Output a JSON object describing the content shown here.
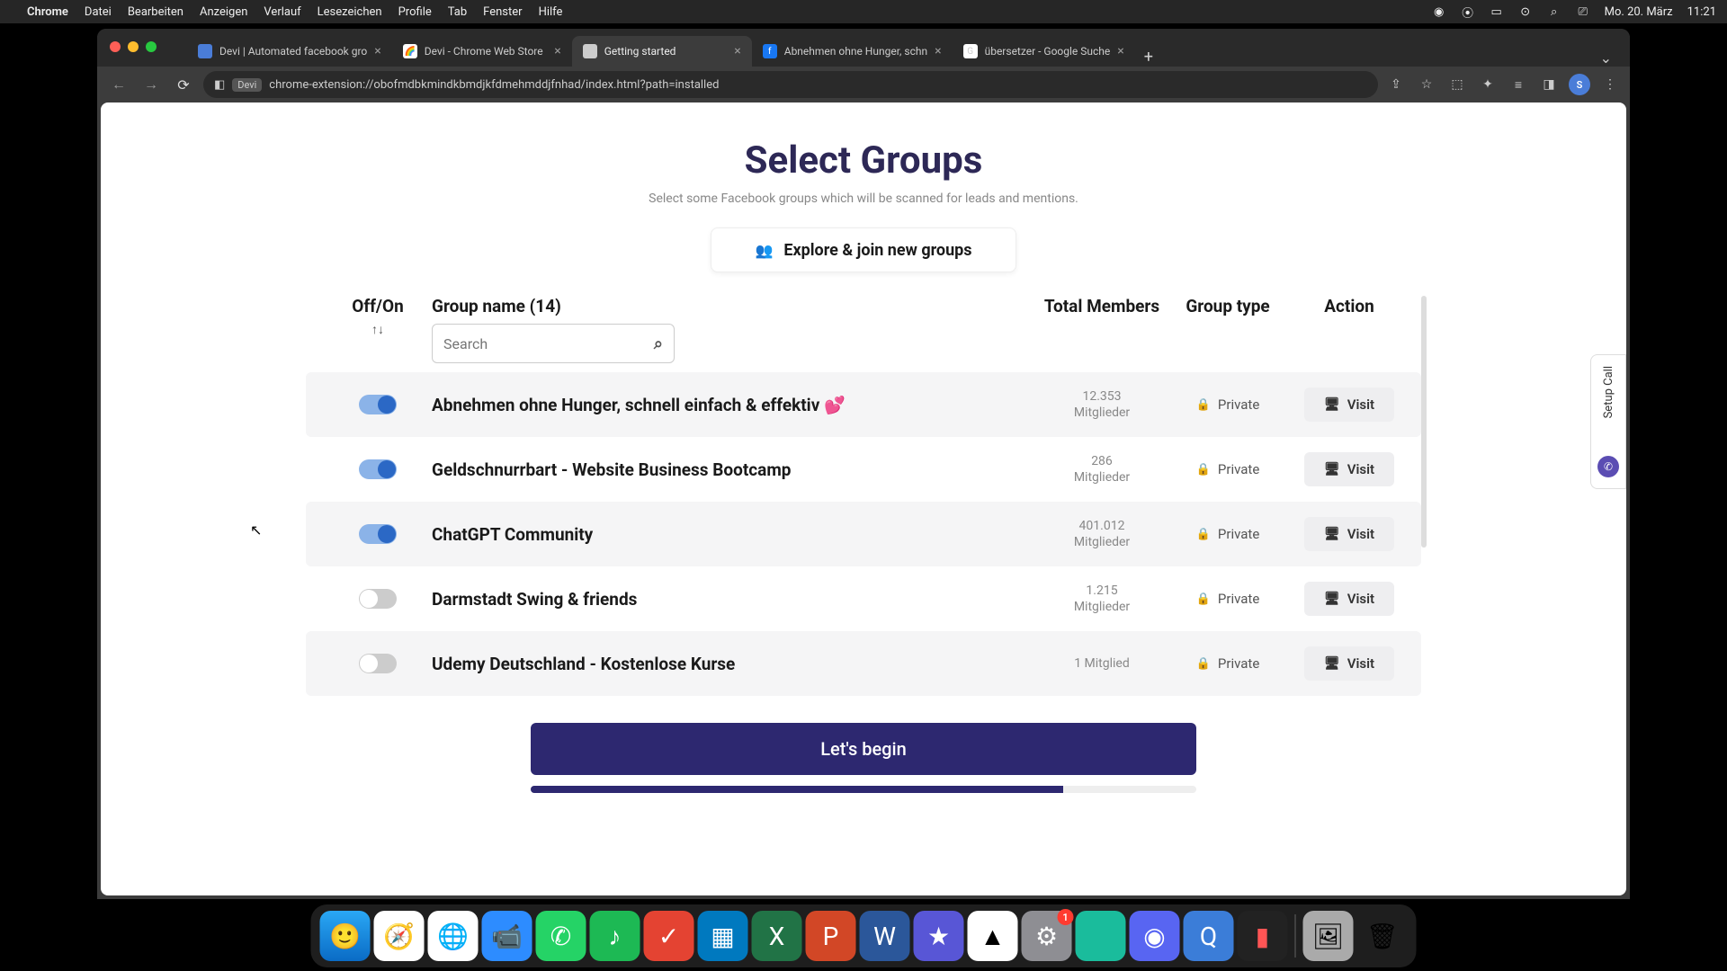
{
  "menubar": {
    "app": "Chrome",
    "items": [
      "Datei",
      "Bearbeiten",
      "Anzeigen",
      "Verlauf",
      "Lesezeichen",
      "Profile",
      "Tab",
      "Fenster",
      "Hilfe"
    ],
    "date": "Mo. 20. März",
    "time": "11:21"
  },
  "tabs": [
    {
      "title": "Devi | Automated facebook gro",
      "favicon_bg": "#4a7dd8"
    },
    {
      "title": "Devi - Chrome Web Store",
      "favicon_bg": "#fff"
    },
    {
      "title": "Getting started",
      "favicon_bg": "#ccc",
      "active": true
    },
    {
      "title": "Abnehmen ohne Hunger, schn",
      "favicon_bg": "#1877f2"
    },
    {
      "title": "übersetzer - Google Suche",
      "favicon_bg": "#fff"
    }
  ],
  "addressbar": {
    "badge": "Devi",
    "url": "chrome-extension://obofmdbkmindkbmdjkfdmehmddjfnhad/index.html?path=installed"
  },
  "avatar_letter": "S",
  "page": {
    "title": "Select Groups",
    "subtitle": "Select some Facebook groups which will be scanned for leads and mentions.",
    "explore_label": "Explore & join new groups",
    "headers": {
      "toggle": "Off/On",
      "name": "Group name (14)",
      "members": "Total Members",
      "type": "Group type",
      "action": "Action"
    },
    "search_placeholder": "Search",
    "rows": [
      {
        "on": true,
        "name": "Abnehmen ohne Hunger, schnell einfach & effektiv 💕",
        "members_count": "12.353",
        "members_label": "Mitglieder",
        "type": "Private",
        "visit": "Visit"
      },
      {
        "on": true,
        "name": "Geldschnurrbart - Website Business Bootcamp",
        "members_count": "286",
        "members_label": "Mitglieder",
        "type": "Private",
        "visit": "Visit"
      },
      {
        "on": true,
        "name": "ChatGPT Community",
        "members_count": "401.012",
        "members_label": "Mitglieder",
        "type": "Private",
        "visit": "Visit"
      },
      {
        "on": false,
        "name": "Darmstadt Swing & friends",
        "members_count": "1.215",
        "members_label": "Mitglieder",
        "type": "Private",
        "visit": "Visit"
      },
      {
        "on": false,
        "name": "Udemy Deutschland - Kostenlose Kurse",
        "members_count": "1 Mitglied",
        "members_label": "",
        "type": "Private",
        "visit": "Visit"
      }
    ],
    "begin_label": "Let's begin",
    "setup_call": "Setup Call"
  },
  "dock": {
    "badge_settings": "1",
    "apps": [
      {
        "name": "finder",
        "bg": "#2aa8f5",
        "glyph": "🙂"
      },
      {
        "name": "safari",
        "bg": "#1e90ff",
        "glyph": "🧭"
      },
      {
        "name": "chrome",
        "bg": "#fff",
        "glyph": "🌐"
      },
      {
        "name": "zoom",
        "bg": "#2d8cff",
        "glyph": "📹"
      },
      {
        "name": "whatsapp",
        "bg": "#25d366",
        "glyph": "✆"
      },
      {
        "name": "spotify",
        "bg": "#1db954",
        "glyph": "♪"
      },
      {
        "name": "todoist",
        "bg": "#e44332",
        "glyph": "✓"
      },
      {
        "name": "trello",
        "bg": "#0079bf",
        "glyph": "▦"
      },
      {
        "name": "excel",
        "bg": "#217346",
        "glyph": "X"
      },
      {
        "name": "powerpoint",
        "bg": "#d24726",
        "glyph": "P"
      },
      {
        "name": "word",
        "bg": "#2b579a",
        "glyph": "W"
      },
      {
        "name": "imovie",
        "bg": "#5856d6",
        "glyph": "★"
      },
      {
        "name": "drive",
        "bg": "#fff",
        "glyph": "▲"
      },
      {
        "name": "settings",
        "bg": "#8e8e93",
        "glyph": "⚙"
      },
      {
        "name": "siri",
        "bg": "#1abc9c",
        "glyph": "◉"
      },
      {
        "name": "discord",
        "bg": "#5865f2",
        "glyph": "◉"
      },
      {
        "name": "quicktime",
        "bg": "#3b7dd8",
        "glyph": "Q"
      },
      {
        "name": "voice",
        "bg": "#222",
        "glyph": "▮"
      },
      {
        "name": "preview",
        "bg": "#888",
        "glyph": "🖼"
      },
      {
        "name": "trash",
        "bg": "#555",
        "glyph": "🗑"
      }
    ]
  }
}
